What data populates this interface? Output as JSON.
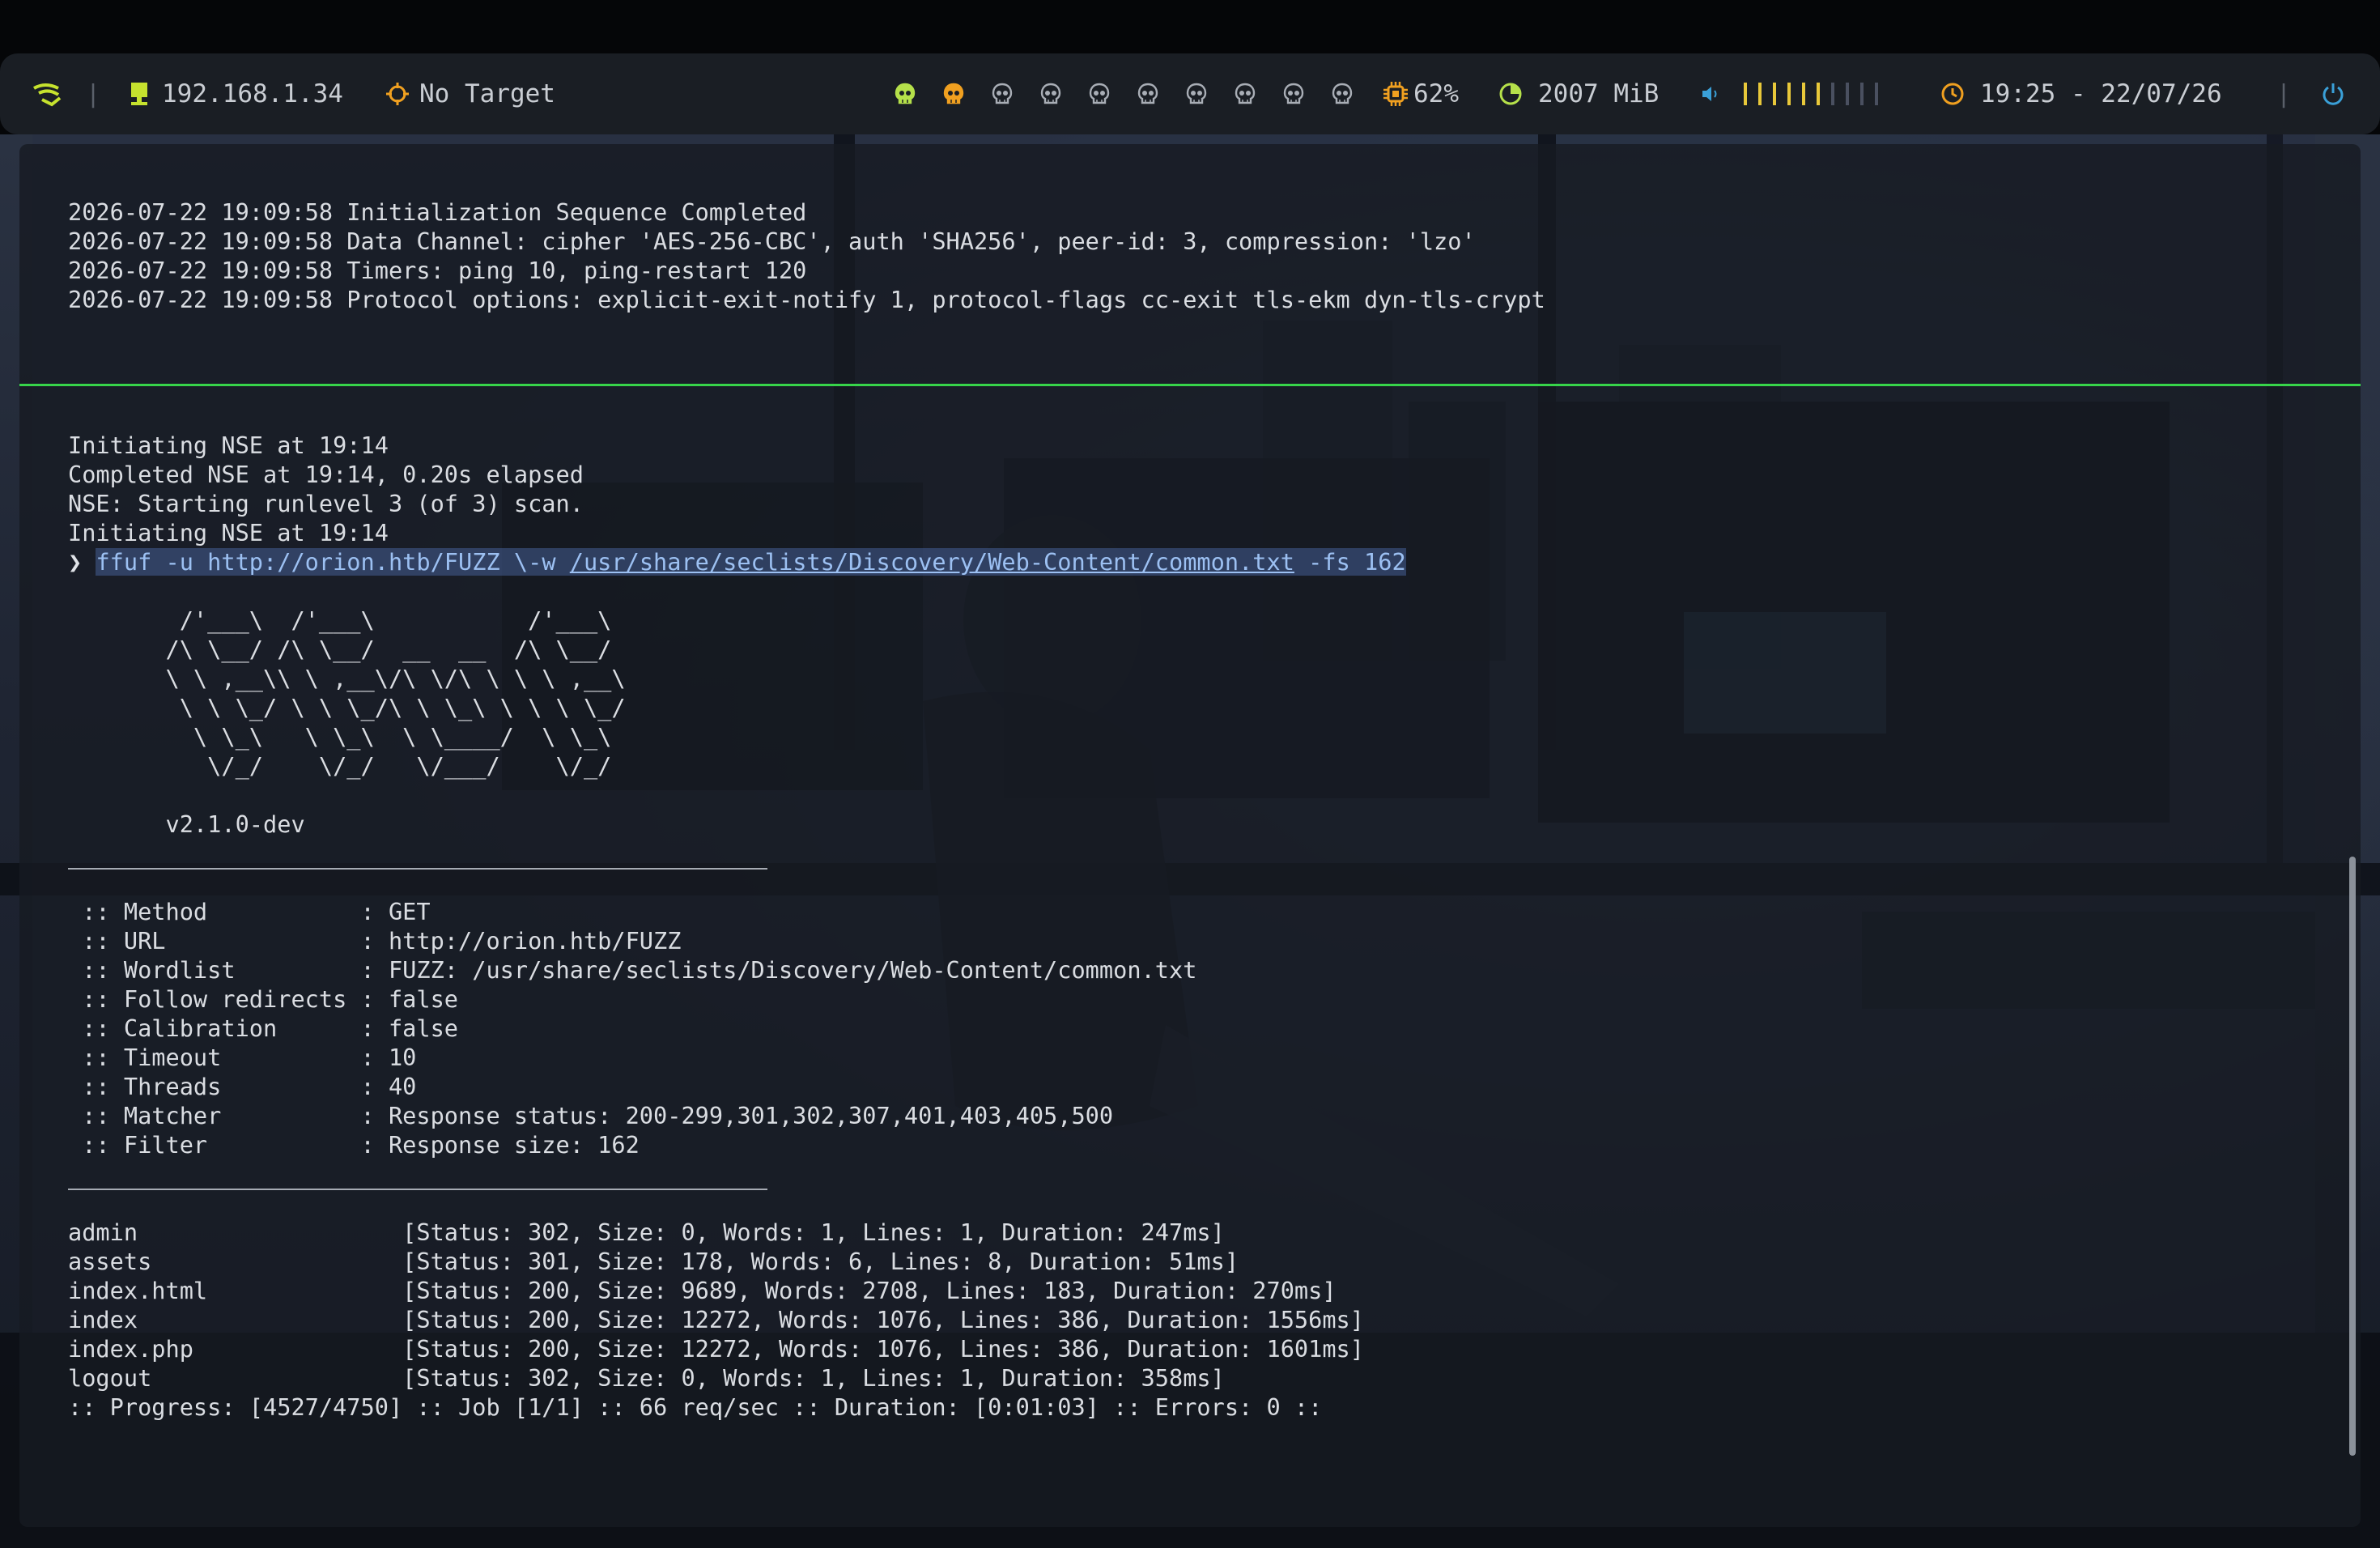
{
  "statusbar": {
    "ip": "192.168.1.34",
    "target": "No Target",
    "cpu": "62%",
    "memory": "2007 MiB",
    "datetime": "19:25 - 22/07/26",
    "workspaces": [
      {
        "icon": "skull-icon",
        "state": "active"
      },
      {
        "icon": "skull-icon",
        "state": "occupied"
      },
      {
        "icon": "skull-icon",
        "state": "empty"
      },
      {
        "icon": "skull-icon",
        "state": "empty"
      },
      {
        "icon": "skull-icon",
        "state": "empty"
      },
      {
        "icon": "skull-icon",
        "state": "empty"
      },
      {
        "icon": "skull-icon",
        "state": "empty"
      },
      {
        "icon": "skull-icon",
        "state": "empty"
      },
      {
        "icon": "skull-icon",
        "state": "empty"
      },
      {
        "icon": "skull-icon",
        "state": "empty"
      }
    ],
    "volume_level": 0.6,
    "volume_bars": 10,
    "colors": {
      "accent_orange": "#f0a020",
      "accent_yellow": "#e8c83a",
      "accent_green": "#b5e04a",
      "power_blue": "#3aa0d8",
      "ip_green": "#c6e22e"
    }
  },
  "terminal": {
    "top_log": [
      "2026-07-22 19:09:58 Initialization Sequence Completed",
      "2026-07-22 19:09:58 Data Channel: cipher 'AES-256-CBC', auth 'SHA256', peer-id: 3, compression: 'lzo'",
      "2026-07-22 19:09:58 Timers: ping 10, ping-restart 120",
      "2026-07-22 19:09:58 Protocol options: explicit-exit-notify 1, protocol-flags cc-exit tls-ekm dyn-tls-crypt"
    ],
    "nse_log": [
      "Initiating NSE at 19:14",
      "Completed NSE at 19:14, 0.20s elapsed",
      "NSE: Starting runlevel 3 (of 3) scan.",
      "Initiating NSE at 19:14"
    ],
    "prompt": "❯",
    "command_pre": "ffuf -u http://orion.htb/FUZZ \\-w ",
    "command_path": "/usr/share/seclists/Discovery/Web-Content/common.txt",
    "command_post": " -fs 162",
    "banner": [
      "        /'___\\  /'___\\           /'___\\",
      "       /\\ \\__/ /\\ \\__/  __  __  /\\ \\__/",
      "       \\ \\ ,__\\\\ \\ ,__\\/\\ \\/\\ \\ \\ \\ ,__\\",
      "        \\ \\ \\_/ \\ \\ \\_/\\ \\ \\_\\ \\ \\ \\ \\_/",
      "         \\ \\_\\   \\ \\_\\  \\ \\____/  \\ \\_\\",
      "          \\/_/    \\/_/   \\/___/    \\/_/"
    ],
    "version": "       v2.1.0-dev",
    "config": [
      " :: Method           : GET",
      " :: URL              : http://orion.htb/FUZZ",
      " :: Wordlist         : FUZZ: /usr/share/seclists/Discovery/Web-Content/common.txt",
      " :: Follow redirects : false",
      " :: Calibration      : false",
      " :: Timeout          : 10",
      " :: Threads          : 40",
      " :: Matcher          : Response status: 200-299,301,302,307,401,403,405,500",
      " :: Filter           : Response size: 162"
    ],
    "results": [
      "admin                   [Status: 302, Size: 0, Words: 1, Lines: 1, Duration: 247ms]",
      "assets                  [Status: 301, Size: 178, Words: 6, Lines: 8, Duration: 51ms]",
      "index.html              [Status: 200, Size: 9689, Words: 2708, Lines: 183, Duration: 270ms]",
      "index                   [Status: 200, Size: 12272, Words: 1076, Lines: 386, Duration: 1556ms]",
      "index.php               [Status: 200, Size: 12272, Words: 1076, Lines: 386, Duration: 1601ms]",
      "logout                  [Status: 302, Size: 0, Words: 1, Lines: 1, Duration: 358ms]"
    ],
    "progress": ":: Progress: [4527/4750] :: Job [1/1] :: 66 req/sec :: Duration: [0:01:03] :: Errors: 0 ::"
  }
}
